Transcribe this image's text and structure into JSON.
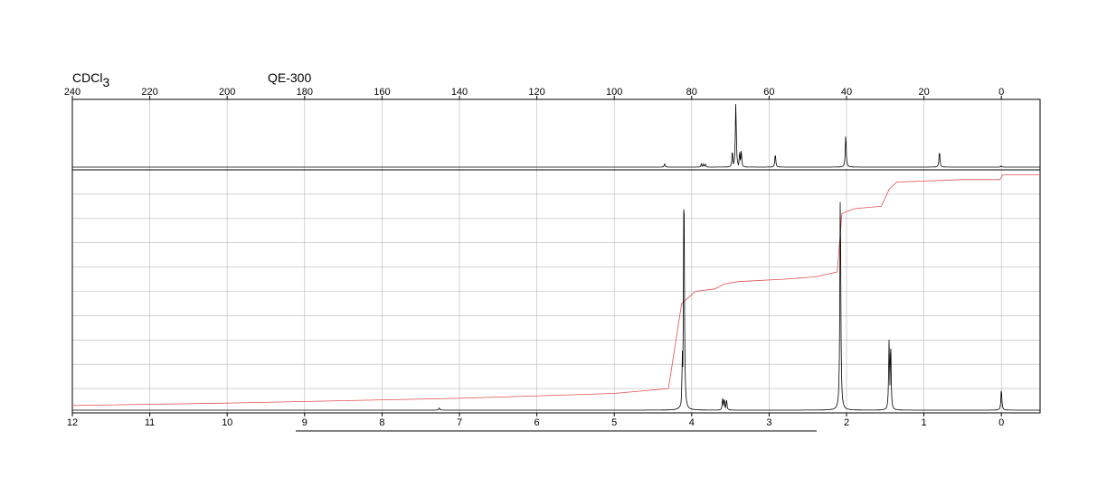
{
  "header": {
    "solvent_main": "CDCl",
    "solvent_sub": "3",
    "instrument": "QE-300"
  },
  "chart_data": [
    {
      "type": "line",
      "name": "13C spectrum (upper panel)",
      "x_axis": {
        "range": [
          240,
          -10
        ],
        "reversed": true,
        "ticks": [
          240,
          220,
          200,
          180,
          160,
          140,
          120,
          100,
          80,
          60,
          40,
          20,
          0
        ]
      },
      "y_range": [
        0,
        1
      ],
      "grid": true,
      "peaks": [
        {
          "x": 87.0,
          "y": 0.05
        },
        {
          "x": 77.5,
          "y": 0.05
        },
        {
          "x": 77.0,
          "y": 0.05
        },
        {
          "x": 76.5,
          "y": 0.05
        },
        {
          "x": 69.5,
          "y": 0.25
        },
        {
          "x": 68.6,
          "y": 0.98
        },
        {
          "x": 67.6,
          "y": 0.24
        },
        {
          "x": 67.2,
          "y": 0.25
        },
        {
          "x": 58.4,
          "y": 0.2
        },
        {
          "x": 40.2,
          "y": 0.49
        },
        {
          "x": 16.0,
          "y": 0.24
        },
        {
          "x": 0.0,
          "y": 0.02
        }
      ]
    },
    {
      "type": "line",
      "name": "1H spectrum (lower panel)",
      "x_axis": {
        "range": [
          12,
          -0.5
        ],
        "reversed": true,
        "ticks": [
          12,
          11,
          10,
          9,
          8,
          7,
          6,
          5,
          4,
          3,
          2,
          1,
          0
        ]
      },
      "y_range": [
        0,
        1
      ],
      "grid": true,
      "peaks": [
        {
          "x": 7.26,
          "y": 0.01
        },
        {
          "x": 4.1,
          "y": 0.98
        },
        {
          "x": 4.12,
          "y": 0.25
        },
        {
          "x": 3.6,
          "y": 0.05
        },
        {
          "x": 3.58,
          "y": 0.05
        },
        {
          "x": 3.55,
          "y": 0.045
        },
        {
          "x": 2.08,
          "y": 0.93
        },
        {
          "x": 1.45,
          "y": 0.3
        },
        {
          "x": 1.43,
          "y": 0.29
        },
        {
          "x": 0.0,
          "y": 0.09
        }
      ],
      "integral": [
        [
          12,
          0.03
        ],
        [
          10,
          0.04
        ],
        [
          7,
          0.06
        ],
        [
          5,
          0.08
        ],
        [
          4.3,
          0.1
        ],
        [
          4.13,
          0.45
        ],
        [
          3.95,
          0.5
        ],
        [
          3.7,
          0.51
        ],
        [
          3.58,
          0.53
        ],
        [
          3.4,
          0.54
        ],
        [
          2.8,
          0.55
        ],
        [
          2.4,
          0.56
        ],
        [
          2.12,
          0.58
        ],
        [
          2.06,
          0.82
        ],
        [
          1.9,
          0.84
        ],
        [
          1.55,
          0.85
        ],
        [
          1.45,
          0.92
        ],
        [
          1.35,
          0.95
        ],
        [
          0.5,
          0.96
        ],
        [
          0.02,
          0.96
        ],
        [
          -0.02,
          0.98
        ],
        [
          -0.5,
          0.98
        ]
      ]
    }
  ]
}
